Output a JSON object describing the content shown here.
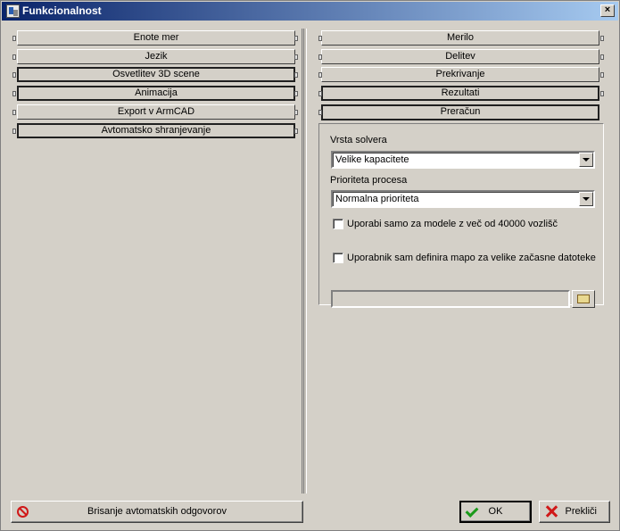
{
  "window": {
    "title": "Funkcionalnost",
    "close_glyph": "×"
  },
  "left_sections": [
    {
      "label": "Enote mer"
    },
    {
      "label": "Jezik"
    },
    {
      "label": "Osvetlitev 3D scene"
    },
    {
      "label": "Animacija"
    },
    {
      "label": "Export v ArmCAD"
    },
    {
      "label": "Avtomatsko shranjevanje"
    }
  ],
  "right_sections": [
    {
      "label": "Merilo"
    },
    {
      "label": "Delitev"
    },
    {
      "label": "Prekrivanje"
    },
    {
      "label": "Rezultati"
    },
    {
      "label": "Preračun"
    }
  ],
  "preracun": {
    "solver_label": "Vrsta solvera",
    "solver_value": "Velike kapacitete",
    "priority_label": "Prioriteta procesa",
    "priority_value": "Normalna prioriteta",
    "check1_label": "Uporabi samo za modele z več od 40000 vozlišč",
    "check1_checked": false,
    "check2_label": "Uporabnik sam definira mapo za velike začasne datoteke",
    "check2_checked": false,
    "folder_path": ""
  },
  "buttons": {
    "reset_label": "Brisanje avtomatskih odgovorov",
    "ok_label": "OK",
    "cancel_label": "Prekliči"
  }
}
